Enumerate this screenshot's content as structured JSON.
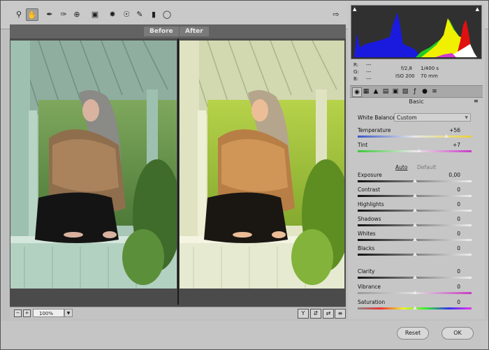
{
  "toolbar": {
    "tools": [
      "zoom-tool-icon",
      "hand-tool-icon",
      "white-balance-icon",
      "color-sampler-icon",
      "targeted-adjust-icon",
      "crop-icon",
      "spot-removal-icon",
      "red-eye-icon",
      "adjustment-brush-icon",
      "graduated-filter-icon",
      "radial-filter-icon"
    ],
    "active_tool": "hand-tool-icon"
  },
  "preview": {
    "before_label": "Before",
    "after_label": "After",
    "zoom_value": "100%"
  },
  "histogram": {
    "colors": {
      "blue": "#1a1adf",
      "green": "#22cc22",
      "yellow": "#f0f000",
      "red": "#e01010",
      "white": "#ffffff",
      "magenta": "#d03ad0"
    }
  },
  "readout": {
    "r_label": "R:",
    "g_label": "G:",
    "b_label": "B:",
    "r_value": "---",
    "g_value": "---",
    "b_value": "---",
    "aperture": "f/2,8",
    "shutter": "1/400 s",
    "iso": "ISO 200",
    "focal": "70 mm"
  },
  "panel": {
    "section_title": "Basic",
    "white_balance_label": "White Balance:",
    "white_balance_value": "Custom",
    "auto_label": "Auto",
    "default_label": "Default",
    "sliders": [
      {
        "label": "Temperature",
        "value": "+56",
        "fraction": 0.78
      },
      {
        "label": "Tint",
        "value": "+7",
        "fraction": 0.54
      },
      {
        "label": "Exposure",
        "value": "0,00",
        "fraction": 0.5
      },
      {
        "label": "Contrast",
        "value": "0",
        "fraction": 0.5
      },
      {
        "label": "Highlights",
        "value": "0",
        "fraction": 0.5
      },
      {
        "label": "Shadows",
        "value": "0",
        "fraction": 0.5
      },
      {
        "label": "Whites",
        "value": "0",
        "fraction": 0.5
      },
      {
        "label": "Blacks",
        "value": "0",
        "fraction": 0.5
      },
      {
        "label": "Clarity",
        "value": "0",
        "fraction": 0.5
      },
      {
        "label": "Vibrance",
        "value": "0",
        "fraction": 0.5
      },
      {
        "label": "Saturation",
        "value": "0",
        "fraction": 0.5
      }
    ]
  },
  "footer": {
    "reset_label": "Reset",
    "ok_label": "OK"
  }
}
